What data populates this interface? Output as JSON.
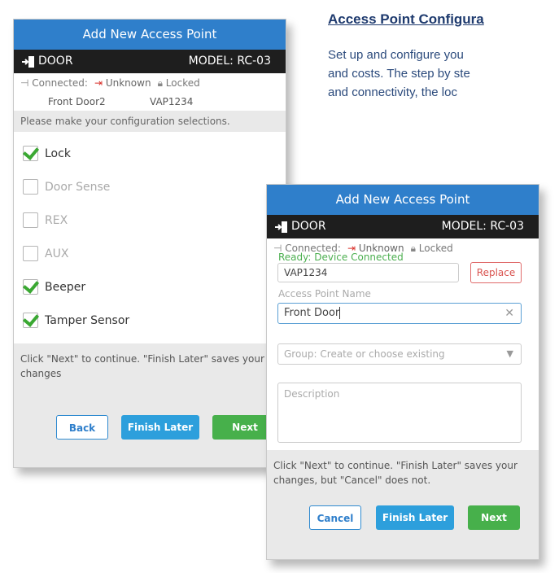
{
  "doc": {
    "heading": "Access Point Configura",
    "para_lines": [
      "Set up and configure you",
      "and costs. The step by ste",
      "and connectivity, the loc"
    ]
  },
  "colors": {
    "title_blue": "#2f7fcb",
    "green_check": "#3aa832",
    "red_icon": "#d9312b"
  },
  "back_dialog": {
    "title": "Add New Access Point",
    "door_label": "DOOR",
    "model": "MODEL: RC-03",
    "status": {
      "connected": "Connected:",
      "unknown": "Unknown",
      "locked": "Locked"
    },
    "info": {
      "name": "Front Door2",
      "id": "VAP1234"
    },
    "hint": "Please make your configuration selections.",
    "options": [
      {
        "label": "Lock",
        "checked": true
      },
      {
        "label": "Door Sense",
        "checked": false
      },
      {
        "label": "REX",
        "checked": false
      },
      {
        "label": "AUX",
        "checked": false
      },
      {
        "label": "Beeper",
        "checked": true
      },
      {
        "label": "Tamper Sensor",
        "checked": true
      }
    ],
    "footer_note": "Click \"Next\" to continue. \"Finish Later\" saves your changes",
    "buttons": {
      "back": "Back",
      "finish_later": "Finish Later",
      "next": "Next"
    }
  },
  "front_dialog": {
    "title": "Add New Access Point",
    "door_label": "DOOR",
    "model": "MODEL: RC-03",
    "status": {
      "connected": "Connected:",
      "unknown": "Unknown",
      "locked": "Locked"
    },
    "ready_label": "Ready: Device Connected",
    "device_id": "VAP1234",
    "replace": "Replace",
    "name_label": "Access Point Name",
    "name_value": "Front Door",
    "group_placeholder": "Group: Create or choose existing",
    "description_placeholder": "Description",
    "footer_note": "Click \"Next\" to continue. \"Finish Later\" saves your changes, but \"Cancel\" does not.",
    "buttons": {
      "cancel": "Cancel",
      "finish_later": "Finish Later",
      "next": "Next"
    }
  }
}
